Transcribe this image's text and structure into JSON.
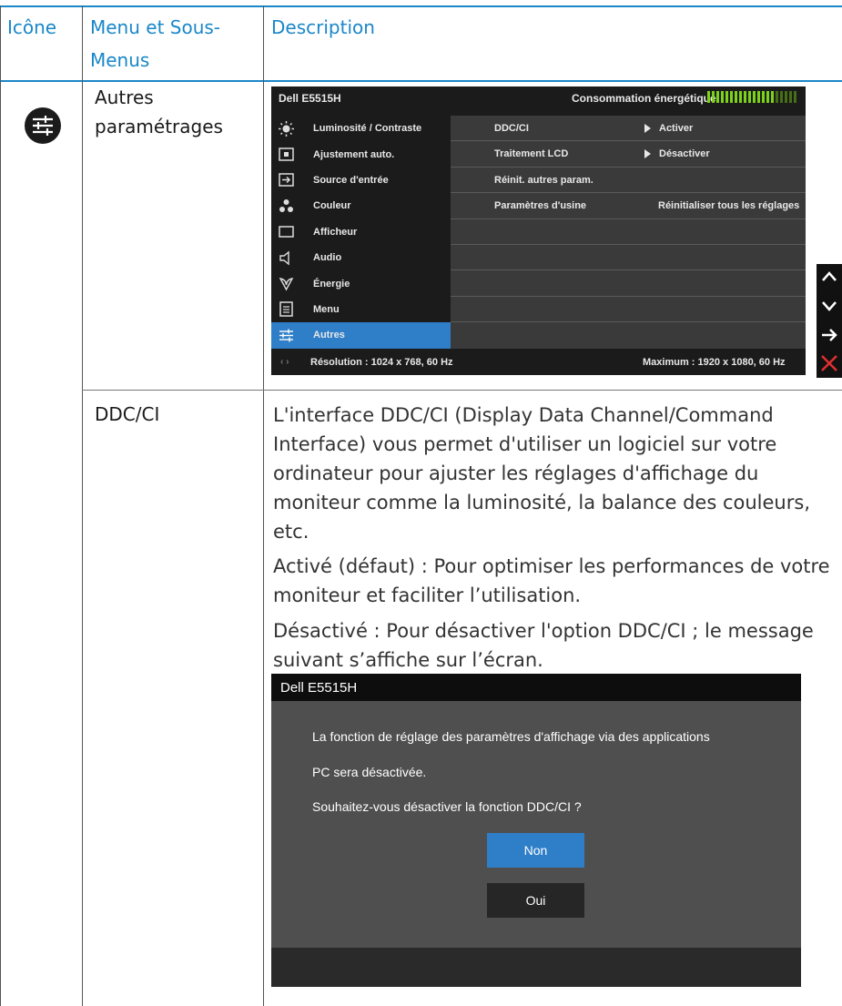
{
  "header": {
    "col_icon": "Icône",
    "col_menu_line1": "Menu et Sous-",
    "col_menu_line2": "Menus",
    "col_desc": "Description"
  },
  "row1": {
    "menu_line1": "Autres",
    "menu_line2": "paramétrages"
  },
  "osd": {
    "title": "Dell E5515H",
    "power_label": "Consommation énergétique",
    "power_level": 0.75,
    "menu_items": [
      {
        "label": "Luminosité / Contraste",
        "icon": "brightness-icon"
      },
      {
        "label": "Ajustement auto.",
        "icon": "auto-adjust-icon"
      },
      {
        "label": "Source d'entrée",
        "icon": "input-source-icon"
      },
      {
        "label": "Couleur",
        "icon": "color-icon"
      },
      {
        "label": "Afficheur",
        "icon": "display-icon"
      },
      {
        "label": "Audio",
        "icon": "audio-icon"
      },
      {
        "label": "Énergie",
        "icon": "energy-icon"
      },
      {
        "label": "Menu",
        "icon": "menu-icon"
      },
      {
        "label": "Autres",
        "icon": "others-icon"
      }
    ],
    "submenu": [
      {
        "label": "DDC/CI",
        "value": "Activer"
      },
      {
        "label": "Traitement LCD",
        "value": "Désactiver"
      },
      {
        "label": "Réinit. autres param.",
        "value": ""
      },
      {
        "label": "Paramètres d'usine",
        "value": "Réinitialiser tous les réglages"
      }
    ],
    "resolution": "Résolution : 1024 x 768, 60 Hz",
    "maximum": "Maximum : 1920 x 1080, 60 Hz",
    "selected_color": "#2f7fc8"
  },
  "row2": {
    "label": "DDC/CI",
    "para1": "L'interface DDC/CI (Display Data Channel/Command Interface) vous permet d'utiliser un logiciel sur votre ordinateur pour ajuster les réglages d'affichage du moniteur comme la luminosité, la balance des couleurs, etc.",
    "para2": "Activé (défaut) : Pour optimiser les performances de votre moniteur et faciliter l’utilisation.",
    "para3": "Désactivé : Pour désactiver l'option DDC/CI ; le message suivant s’affiche sur l’écran."
  },
  "dialog": {
    "title": "Dell E5515H",
    "line1": "La fonction de réglage des paramètres d'affichage via des applications",
    "line2": "PC sera désactivée.",
    "line3": "Souhaitez-vous désactiver la fonction DDC/CI ?",
    "no_label": "Non",
    "yes_label": "Oui"
  },
  "colors": {
    "accent": "#1a87c8",
    "osd_select": "#2f7fc8",
    "power_bar": "#7dd11a",
    "close_red": "#e03030"
  }
}
